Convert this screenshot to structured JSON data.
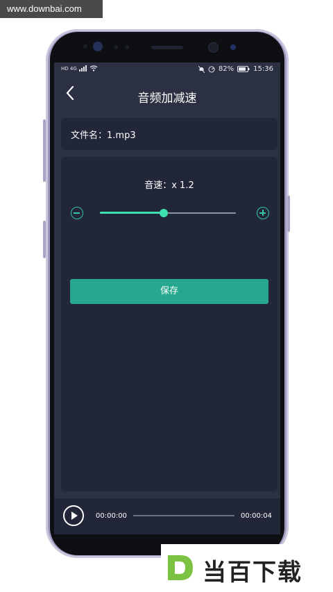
{
  "watermark": {
    "text": "www.downbai.com"
  },
  "status_bar": {
    "left_text": "HD 4G",
    "battery": "82%",
    "time": "15:36"
  },
  "header": {
    "title": "音频加减速",
    "back_icon": "chevron-left-icon"
  },
  "file": {
    "label": "文件名：1.mp3"
  },
  "speed": {
    "label": "音速：x 1.2",
    "value_fraction": 0.47
  },
  "save_button": {
    "label": "保存"
  },
  "player": {
    "current_time": "00:00:00",
    "total_time": "00:00:04",
    "progress_fraction": 0
  },
  "logo": {
    "text": "当百下载"
  },
  "colors": {
    "accent": "#3ee0ae",
    "button": "#27a78e",
    "background": "#2b3142",
    "card": "#212638"
  }
}
